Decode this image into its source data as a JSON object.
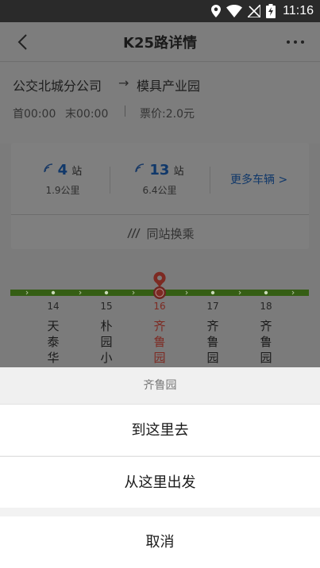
{
  "status_bar": {
    "time": "11:16"
  },
  "nav": {
    "title": "K25路详情"
  },
  "route": {
    "from": "公交北城分公司",
    "arrow": "→",
    "to": "模具产业园",
    "first": "首00:00",
    "last": "末00:00",
    "fare": "票价:2.0元"
  },
  "buses": [
    {
      "count": "4",
      "unit": "站",
      "distance": "1.9公里"
    },
    {
      "count": "13",
      "unit": "站",
      "distance": "6.4公里"
    }
  ],
  "more_buses": "更多车辆 >",
  "transfer": "同站换乘",
  "stops": [
    {
      "num": "14",
      "chars": [
        "天",
        "泰",
        "华"
      ]
    },
    {
      "num": "15",
      "chars": [
        "朴",
        "园",
        "小"
      ]
    },
    {
      "num": "16",
      "chars": [
        "齐",
        "鲁",
        "园"
      ]
    },
    {
      "num": "17",
      "chars": [
        "齐",
        "鲁",
        "园"
      ]
    },
    {
      "num": "18",
      "chars": [
        "齐",
        "鲁",
        "园"
      ]
    }
  ],
  "colors": {
    "accent": "#1a73e8",
    "line": "#6aa82a",
    "active": "#e53935"
  },
  "sheet": {
    "header": "齐鲁园",
    "go_here": "到这里去",
    "depart_here": "从这里出发",
    "cancel": "取消"
  }
}
